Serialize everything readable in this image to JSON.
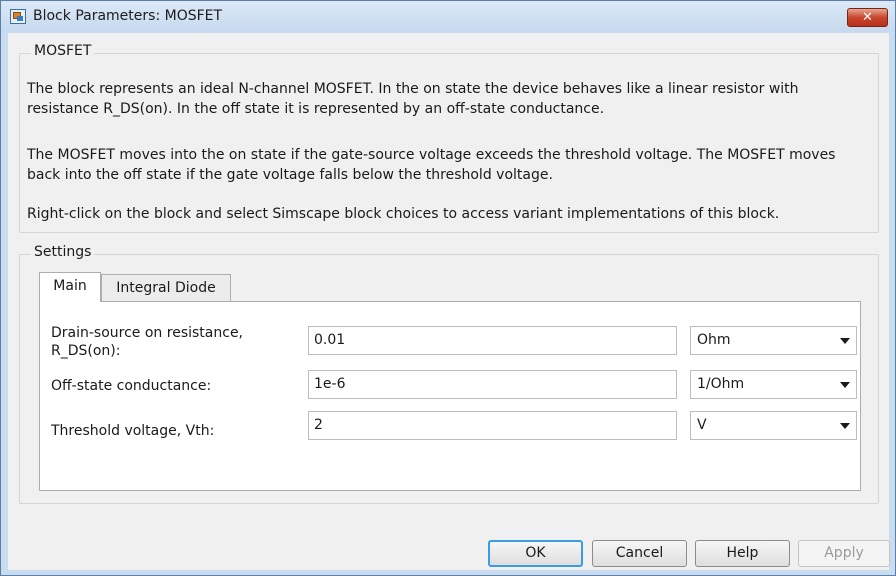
{
  "window": {
    "title": "Block Parameters: MOSFET",
    "close_symbol": "✕",
    "icon": "simulink-block-icon"
  },
  "block_group": {
    "title": "MOSFET",
    "description": [
      "The block represents an ideal N-channel MOSFET. In the on state the device behaves like a linear resistor with resistance R_DS(on). In the off state it is represented by an off-state conductance.",
      "The MOSFET moves into the on state if the gate-source voltage exceeds the threshold voltage. The MOSFET moves back into the off state if the gate voltage falls below the threshold voltage.",
      "Right-click on the block and select Simscape block choices to access variant implementations of this block."
    ]
  },
  "settings": {
    "title": "Settings",
    "tabs": [
      {
        "label": "Main",
        "active": true
      },
      {
        "label": "Integral Diode",
        "active": false
      }
    ],
    "params": [
      {
        "label": "Drain-source on resistance, R_DS(on):",
        "value": "0.01",
        "unit": "Ohm"
      },
      {
        "label": "Off-state conductance:",
        "value": "1e-6",
        "unit": "1/Ohm"
      },
      {
        "label": "Threshold voltage, Vth:",
        "value": "2",
        "unit": "V"
      }
    ]
  },
  "buttons": {
    "ok": "OK",
    "cancel": "Cancel",
    "help": "Help",
    "apply": "Apply"
  },
  "colors": {
    "accent": "#3c9ce0",
    "close_button": "#c7472d",
    "frame": "#c9dcf0"
  }
}
